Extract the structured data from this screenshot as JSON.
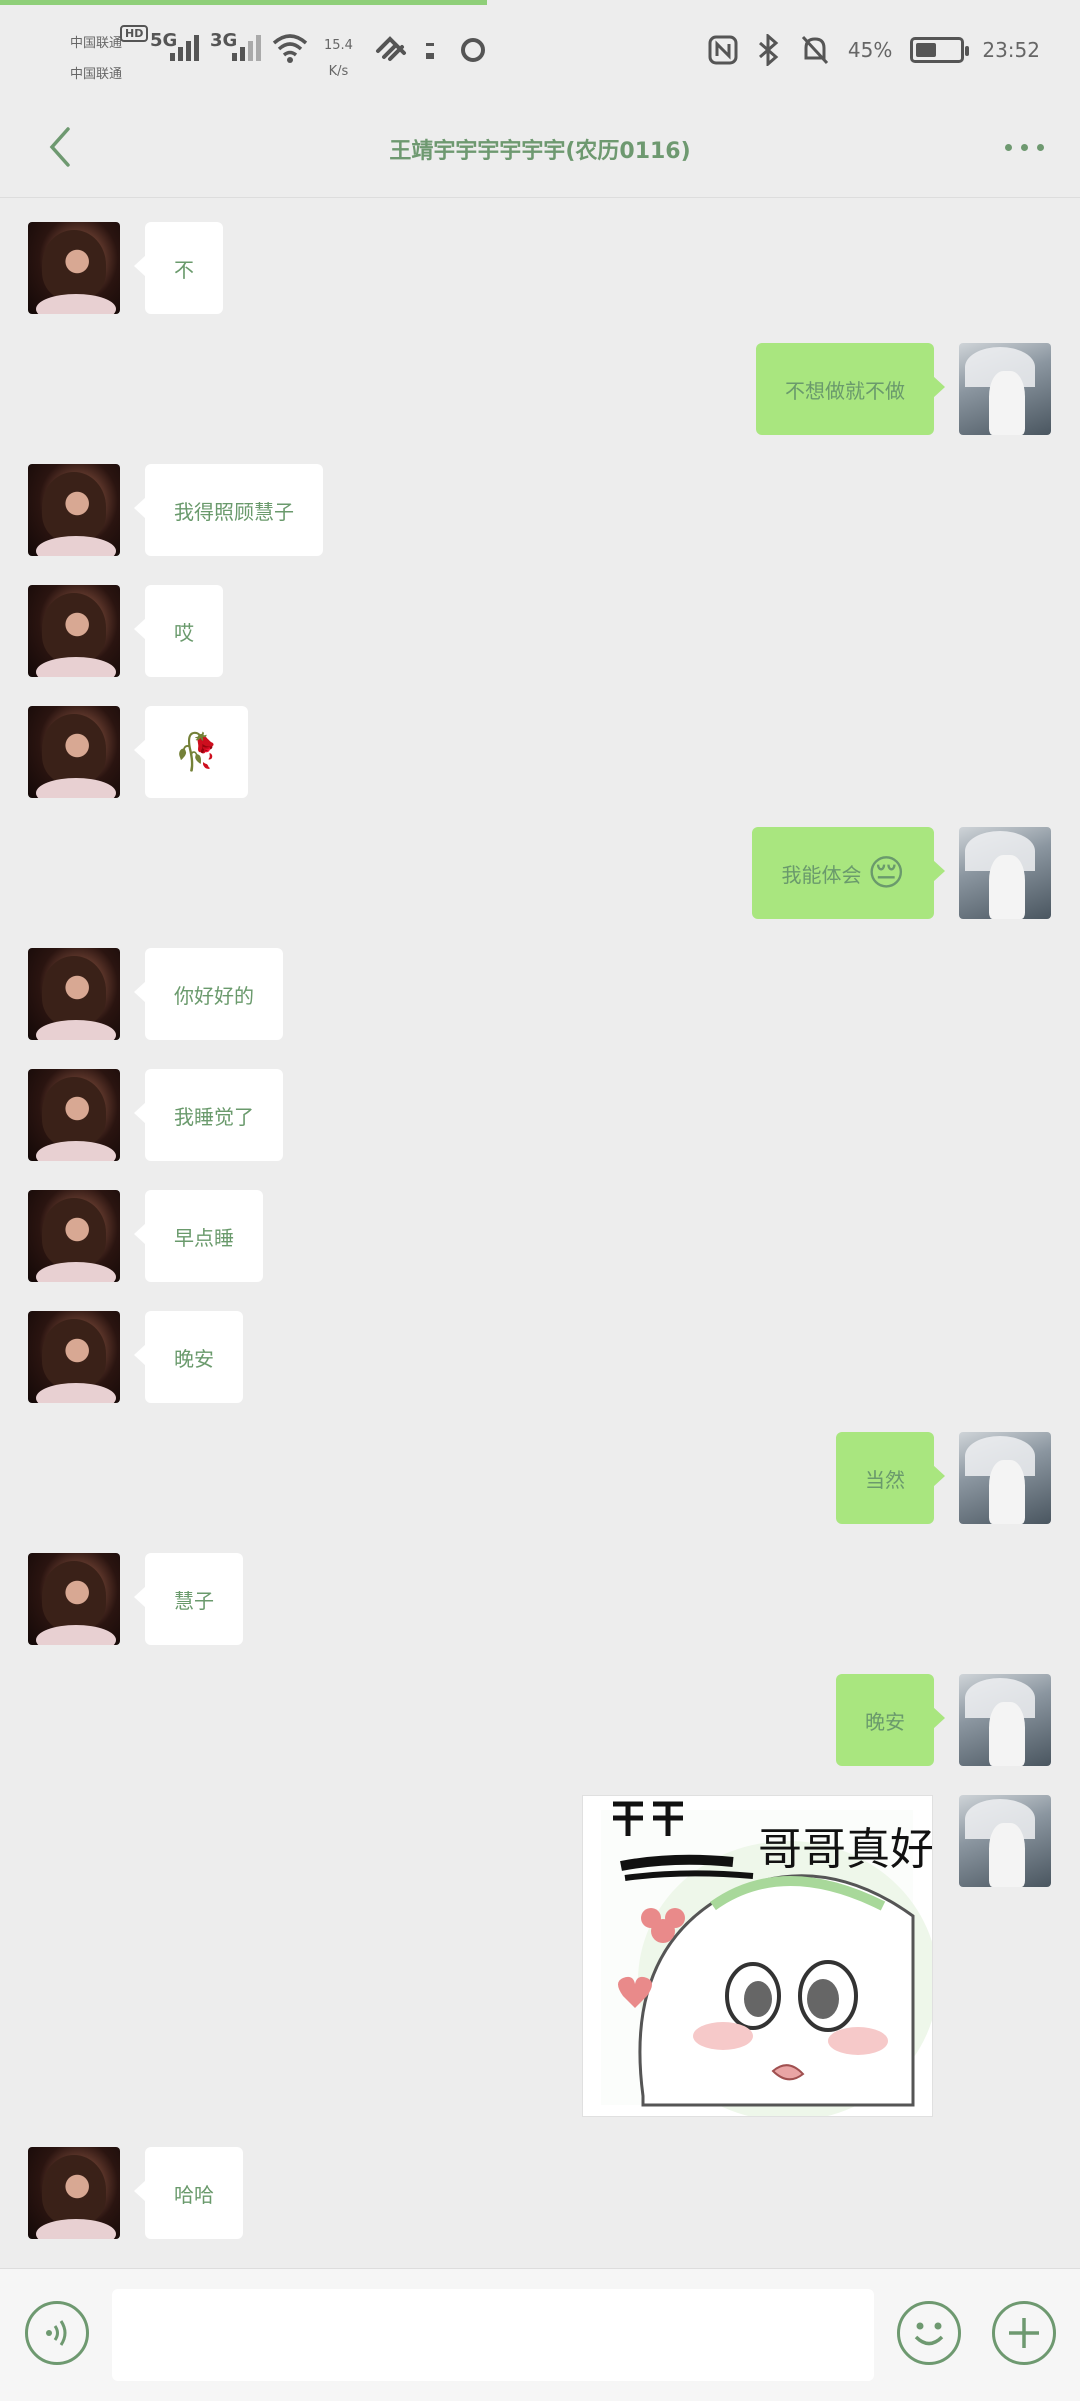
{
  "status_bar": {
    "carrier1": "中国联通",
    "carrier2": "中国联通",
    "hd": "HD",
    "net1": "5G",
    "net2": "3G",
    "speed_value": "15.4",
    "speed_unit": "K/s",
    "battery_percent": "45%",
    "time": "23:52",
    "icons": [
      "nfc-icon",
      "bluetooth-icon",
      "mute-bell-icon",
      "battery-icon",
      "wifi-icon",
      "signal-icon"
    ]
  },
  "header": {
    "title": "王靖宇宇宇宇宇宇(农历0116)"
  },
  "messages": [
    {
      "side": "left",
      "text": "不"
    },
    {
      "side": "right",
      "text": "不想做就不做"
    },
    {
      "side": "left",
      "text": "我得照顾慧子"
    },
    {
      "side": "left",
      "text": "哎"
    },
    {
      "side": "left",
      "emoji": "🥀"
    },
    {
      "side": "right",
      "text": "我能体会",
      "emoji": "😔"
    },
    {
      "side": "left",
      "text": "你好好的"
    },
    {
      "side": "left",
      "text": "我睡觉了"
    },
    {
      "side": "left",
      "text": "早点睡"
    },
    {
      "side": "left",
      "text": "晚安"
    },
    {
      "side": "right",
      "text": "当然"
    },
    {
      "side": "left",
      "text": "慧子"
    },
    {
      "side": "right",
      "text": "晚安"
    },
    {
      "side": "right",
      "sticker_text": "哥哥真好"
    },
    {
      "side": "left",
      "text": "哈哈"
    }
  ],
  "colors": {
    "background": "#ededed",
    "sent_bubble": "#a9e67f",
    "received_bubble": "#ffffff",
    "accent": "#6e9970"
  }
}
